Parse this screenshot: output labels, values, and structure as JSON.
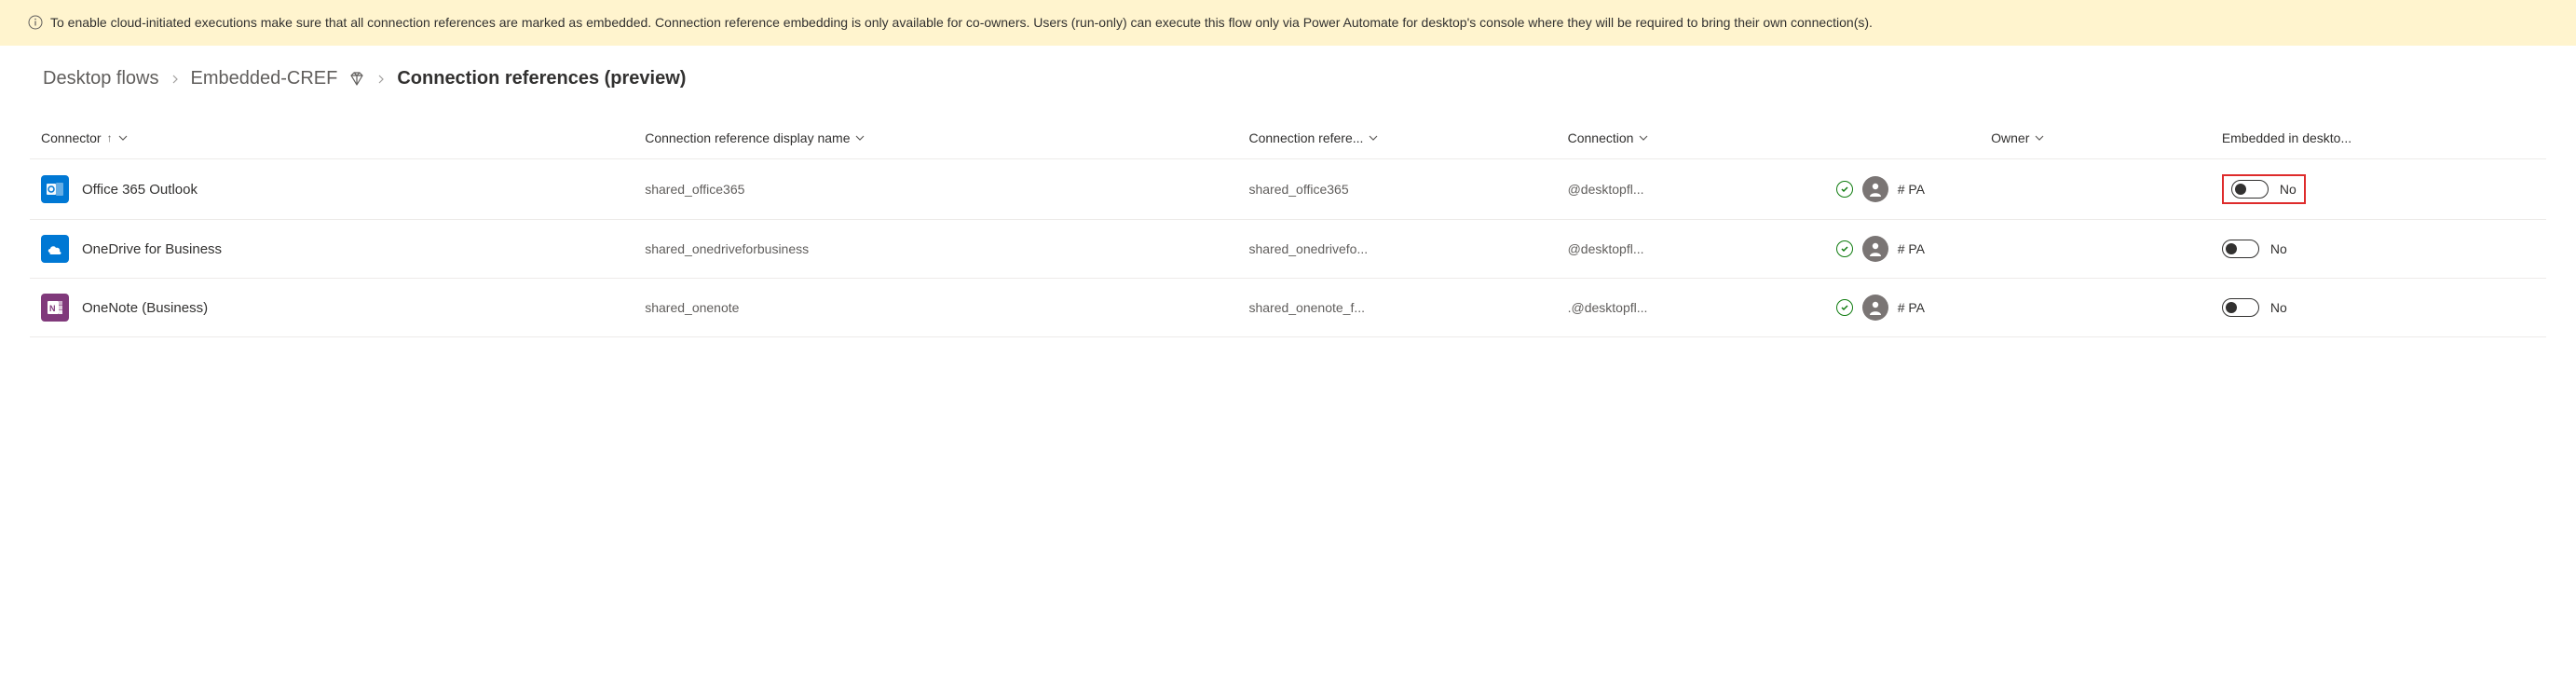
{
  "banner": {
    "text": "To enable cloud-initiated executions make sure that all connection references are marked as embedded. Connection reference embedding is only available for co-owners. Users (run-only) can execute this flow only via Power Automate for desktop's console where they will be required to bring their own connection(s)."
  },
  "breadcrumb": {
    "root": "Desktop flows",
    "flow": "Embedded-CREF",
    "current": "Connection references (preview)"
  },
  "columns": {
    "connector": "Connector",
    "display_name": "Connection reference display name",
    "reference": "Connection refere...",
    "connection": "Connection",
    "owner": "Owner",
    "embedded": "Embedded in deskto..."
  },
  "rows": [
    {
      "icon_color": "#0078D4",
      "icon_key": "outlook",
      "connector": "Office 365 Outlook",
      "display_name": "shared_office365",
      "reference": "shared_office365",
      "connection": "@desktopfl...",
      "owner": "# PA",
      "embedded_label": "No",
      "highlight": true
    },
    {
      "icon_color": "#0078D4",
      "icon_key": "onedrive",
      "connector": "OneDrive for Business",
      "display_name": "shared_onedriveforbusiness",
      "reference": "shared_onedrivefo...",
      "connection": "@desktopfl...",
      "owner": "# PA",
      "embedded_label": "No",
      "highlight": false
    },
    {
      "icon_color": "#80397B",
      "icon_key": "onenote",
      "connector": "OneNote (Business)",
      "display_name": "shared_onenote",
      "reference": "shared_onenote_f...",
      "connection": ".@desktopfl...",
      "owner": "# PA",
      "embedded_label": "No",
      "highlight": false
    }
  ]
}
